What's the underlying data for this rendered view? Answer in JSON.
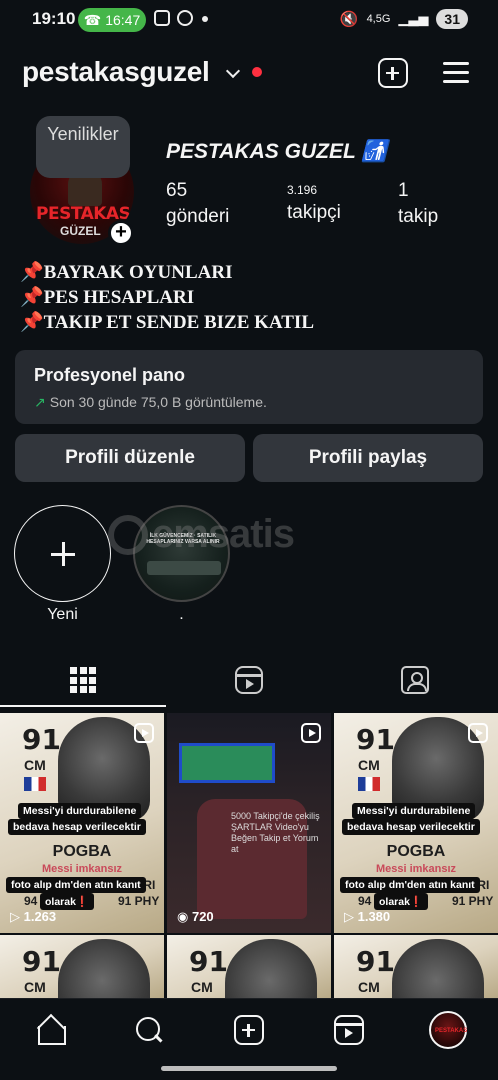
{
  "status_bar": {
    "time": "19:10",
    "call_timer": "16:47",
    "network": "4,5G",
    "battery": "31"
  },
  "header": {
    "username": "pestakasguzel"
  },
  "profile": {
    "note": "Yenilikler",
    "avatar_text_1": "PESTAKAS",
    "avatar_text_2": "GÜZEL",
    "display_name": "PESTAKAS GUZEL 🚮",
    "posts_count": "65",
    "posts_label": "gönderi",
    "followers_count": "3.196",
    "followers_label": "takipçi",
    "following_count": "1",
    "following_label": "takip",
    "bio": [
      "BAYRAK OYUNLARI",
      "PES HESAPLARI",
      "TAKIP ET SENDE BIZE KATIL"
    ]
  },
  "dashboard": {
    "title": "Profesyonel pano",
    "subtitle": "Son 30 günde 75,0 B görüntüleme."
  },
  "buttons": {
    "edit_profile": "Profili düzenle",
    "share_profile": "Profili paylaş"
  },
  "highlights": [
    {
      "label": "Yeni"
    },
    {
      "label": "."
    }
  ],
  "watermark": "emsatis",
  "posts": [
    {
      "rating": "91",
      "position": "CM",
      "name": "POGBA",
      "red_text": "Messi imkansız",
      "caption_1": "Messi'yi durdurabilene",
      "caption_2": "bedava hesap verilecektir",
      "caption_3": "foto alıp dm'den atın kanıt",
      "caption_4": "olarak❗",
      "stats_left": "86 PAC\n94 PAS",
      "stats_right": "96 DRI\n91 PHY",
      "views": "1.263"
    },
    {
      "views": "720",
      "text": "5000 Takipçi'de çekiliş ŞARTLAR Video'yu Beğen Takip et Yorum at"
    },
    {
      "rating": "91",
      "position": "CM",
      "name": "POGBA",
      "red_text": "Messi imkansız",
      "caption_1": "Messi'yi durdurabilene",
      "caption_2": "bedava hesap verilecektir",
      "caption_3": "foto alıp dm'den atın kanıt",
      "caption_4": "olarak❗",
      "stats_left": "86 PAC\n94 PAS",
      "stats_right": "96 DRI\n91 PHY",
      "views": "1.380"
    }
  ],
  "icons": {
    "header": [
      "create-icon",
      "menu-icon"
    ],
    "tabs": [
      "grid-icon",
      "reels-icon",
      "tagged-icon"
    ],
    "nav": [
      "home-icon",
      "search-icon",
      "create-icon",
      "reels-icon",
      "profile-avatar"
    ]
  }
}
